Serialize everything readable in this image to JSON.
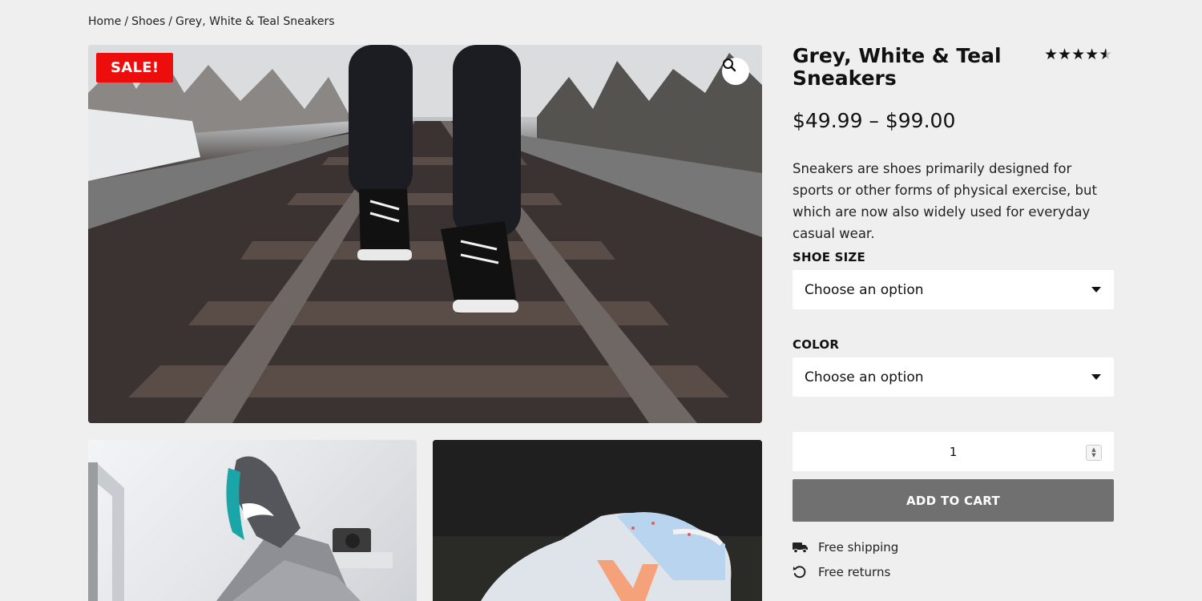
{
  "breadcrumb": {
    "home": "Home",
    "category": "Shoes",
    "current": "Grey, White & Teal Sneakers",
    "separator": "/"
  },
  "gallery": {
    "sale_badge": "SALE!",
    "zoom_icon": "magnifier-icon"
  },
  "product": {
    "title": "Grey, White & Teal Sneakers",
    "rating": 4.5,
    "rating_max": 5,
    "price": "$49.99 – $99.00",
    "description": "Sneakers are shoes primarily designed for sports or other forms of physical exercise, but which are now also widely used for everyday casual wear."
  },
  "options": {
    "size_label": "SHOE SIZE",
    "size_value": "Choose an option",
    "color_label": "COLOR",
    "color_value": "Choose an option"
  },
  "cart": {
    "quantity": "1",
    "add_label": "ADD TO CART"
  },
  "perks": {
    "shipping": "Free shipping",
    "shipping_icon": "truck-icon",
    "returns": "Free returns",
    "returns_icon": "return-arrow-icon"
  },
  "colors": {
    "background": "#efefef",
    "sale": "#ee0d0d",
    "button": "#707070"
  }
}
